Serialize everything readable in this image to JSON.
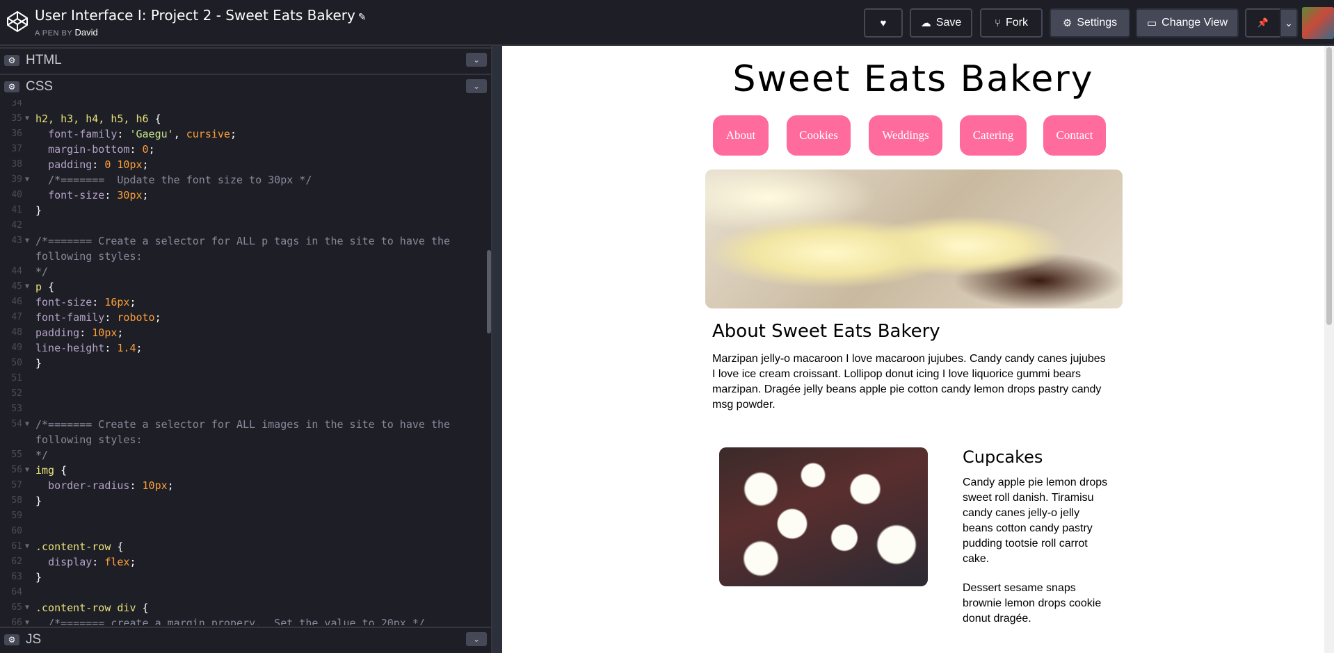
{
  "header": {
    "title": "User Interface I: Project 2 - Sweet Eats Bakery",
    "pencil": "✎",
    "byline_prefix": "A PEN BY",
    "author": "David",
    "buttons": {
      "heart_icon": "♥",
      "save_icon": "☁",
      "save": "Save",
      "fork_icon": "⑂",
      "fork": "Fork",
      "settings_icon": "⚙",
      "settings": "Settings",
      "changeview_icon": "▭",
      "change_view": "Change View",
      "pin_icon": "📌",
      "caret": "⌄"
    }
  },
  "editor": {
    "panels": [
      {
        "name": "HTML",
        "gear": "⚙",
        "chevron": "⌄"
      },
      {
        "name": "CSS",
        "gear": "⚙",
        "chevron": "⌄"
      },
      {
        "name": "JS",
        "gear": "⚙",
        "chevron": "⌄"
      }
    ],
    "lines": [
      {
        "n": "34",
        "fold": "",
        "html": ""
      },
      {
        "n": "35",
        "fold": "▼",
        "html": "<span class='c-sel'>h2, h3, h4, h5, h6</span> <span class='c-pun'>{</span>"
      },
      {
        "n": "36",
        "fold": "",
        "html": "  <span class='c-prop'>font-family</span>: <span class='c-str'>'Gaegu'</span>, <span class='c-val'>cursive</span>;"
      },
      {
        "n": "37",
        "fold": "",
        "html": "  <span class='c-prop'>margin-bottom</span>: <span class='c-val'>0</span>;"
      },
      {
        "n": "38",
        "fold": "",
        "html": "  <span class='c-prop'>padding</span>: <span class='c-val'>0 10px</span>;"
      },
      {
        "n": "39",
        "fold": "▼",
        "html": "  <span class='c-com'>/*=======  Update the font size to 30px */</span>"
      },
      {
        "n": "40",
        "fold": "",
        "html": "  <span class='c-prop'>font-size</span>: <span class='c-val'>30px</span>;"
      },
      {
        "n": "41",
        "fold": "",
        "html": "}"
      },
      {
        "n": "42",
        "fold": "",
        "html": ""
      },
      {
        "n": "43",
        "fold": "▼",
        "html": "<span class='c-com'>/*======= Create a selector for ALL p tags in the site to have the</span>"
      },
      {
        "n": "",
        "fold": "",
        "html": "<span class='c-com'>following styles:</span>"
      },
      {
        "n": "44",
        "fold": "",
        "html": "<span class='c-com'>*/</span>"
      },
      {
        "n": "45",
        "fold": "▼",
        "html": "<span class='c-sel'>p</span> {"
      },
      {
        "n": "46",
        "fold": "",
        "html": "<span class='c-prop'>font-size</span>: <span class='c-val'>16px</span>;"
      },
      {
        "n": "47",
        "fold": "",
        "html": "<span class='c-prop'>font-family</span>: <span class='c-val'>roboto</span>;"
      },
      {
        "n": "48",
        "fold": "",
        "html": "<span class='c-prop'>padding</span>: <span class='c-val'>10px</span>;"
      },
      {
        "n": "49",
        "fold": "",
        "html": "<span class='c-prop'>line-height</span>: <span class='c-val'>1.4</span>;"
      },
      {
        "n": "50",
        "fold": "",
        "html": "}"
      },
      {
        "n": "51",
        "fold": "",
        "html": ""
      },
      {
        "n": "52",
        "fold": "",
        "html": ""
      },
      {
        "n": "53",
        "fold": "",
        "html": ""
      },
      {
        "n": "54",
        "fold": "▼",
        "html": "<span class='c-com'>/*======= Create a selector for ALL images in the site to have the</span>"
      },
      {
        "n": "",
        "fold": "",
        "html": "<span class='c-com'>following styles:</span>"
      },
      {
        "n": "55",
        "fold": "",
        "html": "<span class='c-com'>*/</span>"
      },
      {
        "n": "56",
        "fold": "▼",
        "html": "<span class='c-sel'>img</span> {"
      },
      {
        "n": "57",
        "fold": "",
        "html": "  <span class='c-prop'>border-radius</span>: <span class='c-val'>10px</span>;"
      },
      {
        "n": "58",
        "fold": "",
        "html": "}"
      },
      {
        "n": "59",
        "fold": "",
        "html": ""
      },
      {
        "n": "60",
        "fold": "",
        "html": ""
      },
      {
        "n": "61",
        "fold": "▼",
        "html": "<span class='c-sel'>.content-row</span> {"
      },
      {
        "n": "62",
        "fold": "",
        "html": "  <span class='c-prop'>display</span>: <span class='c-val'>flex</span>;"
      },
      {
        "n": "63",
        "fold": "",
        "html": "}"
      },
      {
        "n": "64",
        "fold": "",
        "html": ""
      },
      {
        "n": "65",
        "fold": "▼",
        "html": "<span class='c-sel'>.content-row div</span> {"
      },
      {
        "n": "66",
        "fold": "▼",
        "html": "  <span class='c-com'>/*======= create a margin propery.  Set the value to 20px */</span>"
      }
    ]
  },
  "preview": {
    "site_title": "Sweet Eats Bakery",
    "nav": [
      "About",
      "Cookies",
      "Weddings",
      "Catering",
      "Contact"
    ],
    "about_heading": "About Sweet Eats Bakery",
    "about_text": "Marzipan jelly-o macaroon I love macaroon jujubes. Candy candy canes jujubes I love ice cream croissant. Lollipop donut icing I love liquorice gummi bears marzipan. Dragée jelly beans apple pie cotton candy lemon drops pastry candy msg powder.",
    "cupcakes_heading": "Cupcakes",
    "cupcakes_p1": "Candy apple pie lemon drops sweet roll danish. Tiramisu candy canes jelly-o jelly beans cotton candy pastry pudding tootsie roll carrot cake.",
    "cupcakes_p2": "Dessert sesame snaps brownie lemon drops cookie donut dragée."
  },
  "colors": {
    "nav_pink": "#ff6b9d",
    "editor_bg": "#1e1f26",
    "button_bg": "#444857"
  }
}
